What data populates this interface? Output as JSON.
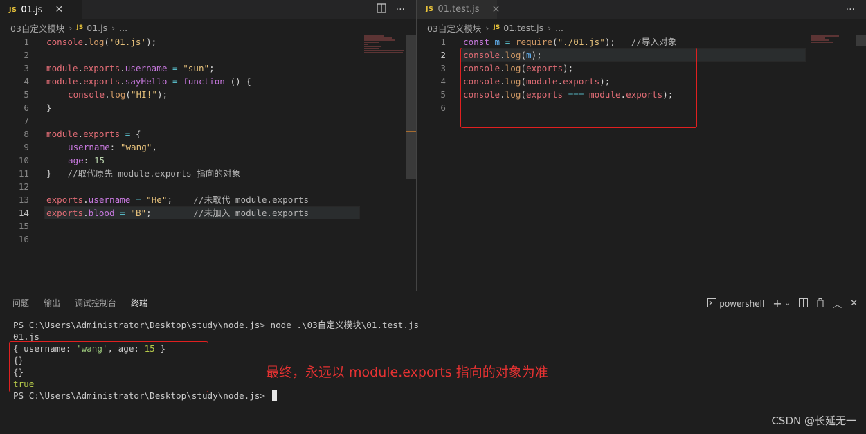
{
  "left_editor": {
    "tab_icon": "JS",
    "tab_label": "01.js",
    "breadcrumb": [
      "03自定义模块",
      "01.js",
      "..."
    ],
    "lines": [
      "1",
      "2",
      "3",
      "4",
      "5",
      "6",
      "7",
      "8",
      "9",
      "10",
      "11",
      "12",
      "13",
      "14",
      "15",
      "16"
    ],
    "current_line": "14"
  },
  "right_editor": {
    "tab_icon": "JS",
    "tab_label": "01.test.js",
    "breadcrumb": [
      "03自定义模块",
      "01.test.js",
      "..."
    ],
    "lines": [
      "1",
      "2",
      "3",
      "4",
      "5",
      "6"
    ],
    "current_line": "2"
  },
  "icons": {
    "close": "close-icon",
    "split": "split-editor-icon",
    "more": "more-icon",
    "chevron": "chevron-right-icon",
    "terminal": "terminal-icon",
    "plus": "plus-icon",
    "trash": "trash-icon",
    "maximize": "chevron-up-icon",
    "close_panel": "close-icon"
  },
  "panel": {
    "tabs": [
      "问题",
      "输出",
      "调试控制台",
      "终端"
    ],
    "active_tab": "终端",
    "shell_label": "powershell",
    "terminal_lines": [
      "PS C:\\Users\\Administrator\\Desktop\\study\\node.js> node .\\03自定义模块\\01.test.js",
      "01.js",
      "{ username: 'wang', age: 15 }",
      "{}",
      "{}",
      "true",
      "PS C:\\Users\\Administrator\\Desktop\\study\\node.js> "
    ]
  },
  "annotation": "最终，永远以 module.exports 指向的对象为准",
  "watermark": "CSDN @长延无一",
  "colors": {
    "background": "#1e1e1e",
    "highlight_box": "#e02020",
    "annotation": "#e53232"
  }
}
